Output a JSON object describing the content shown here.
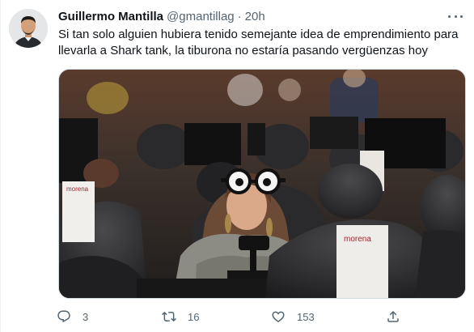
{
  "tweet": {
    "author_name": "Guillermo Mantilla",
    "author_handle": "@gmantillag",
    "separator": "·",
    "time": "20h",
    "text_lines": [
      "Si tan solo alguien hubiera tenido semejante idea de emprendimiento para",
      "llevarla a Shark tank, la tiburona no estaría pasando vergüenzas hoy"
    ]
  },
  "media": {
    "sign_labels": [
      "morena",
      "morena"
    ]
  },
  "actions": {
    "reply_count": "3",
    "retweet_count": "16",
    "like_count": "153"
  },
  "icons": {
    "more": "more-icon",
    "reply": "reply-icon",
    "retweet": "retweet-icon",
    "like": "like-icon",
    "share": "share-icon"
  },
  "colors": {
    "text": "#0f1419",
    "secondary": "#536471",
    "border": "#cfd9de"
  }
}
